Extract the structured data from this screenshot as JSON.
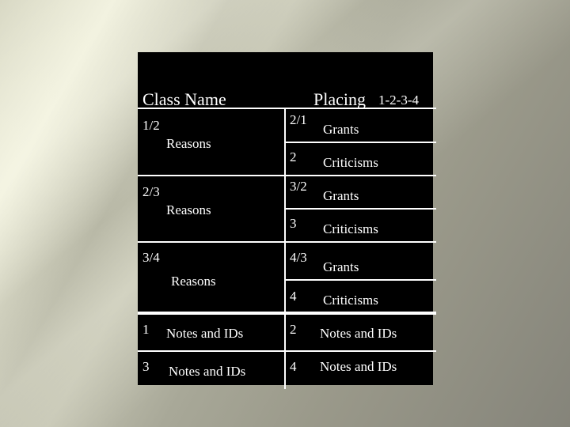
{
  "header": {
    "class_name": "Class Name",
    "placing": "Placing",
    "placing_order": "1-2-3-4"
  },
  "left_blocks": [
    {
      "pair": "1/2",
      "label": "Reasons"
    },
    {
      "pair": "2/3",
      "label": "Reasons"
    },
    {
      "pair": "3/4",
      "label": "Reasons"
    }
  ],
  "right_rows": [
    {
      "rank": "2/1",
      "label": "Grants"
    },
    {
      "rank": "2",
      "label": "Criticisms"
    },
    {
      "rank": "3/2",
      "label": "Grants"
    },
    {
      "rank": "3",
      "label": "Criticisms"
    },
    {
      "rank": "4/3",
      "label": "Grants"
    },
    {
      "rank": "4",
      "label": "Criticisms"
    }
  ],
  "notes_rows": [
    {
      "rank": "1",
      "label": "Notes and IDs"
    },
    {
      "rank": "2",
      "label": "Notes and IDs"
    },
    {
      "rank": "3",
      "label": "Notes and IDs"
    },
    {
      "rank": "4",
      "label": "Notes and IDs"
    }
  ],
  "colors": {
    "panel": "#000000",
    "text": "#ffffff",
    "lines": "#ffffff"
  }
}
